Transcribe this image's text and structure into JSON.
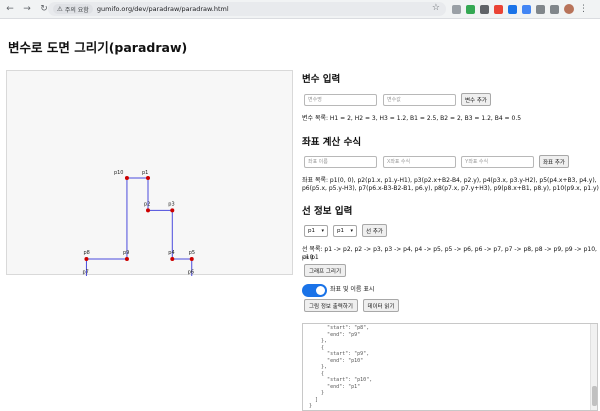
{
  "browser": {
    "security_label": "주의 요함",
    "url": "gumifo.org/dev/paradraw/paradraw.html"
  },
  "page": {
    "title": "변수로 도면 그리기(paradraw)"
  },
  "variables": {
    "heading": "변수 입력",
    "name_placeholder": "변수명",
    "value_placeholder": "변수값",
    "add_label": "변수 추가",
    "list_text": "변수 목록: H1 = 2, H2 = 3, H3 = 1.2, B1 = 2.5, B2 = 2, B3 = 1.2, B4 = 0.5"
  },
  "coords": {
    "heading": "좌표 계산 수식",
    "name_placeholder": "좌표 이름",
    "x_placeholder": "X좌표 수식",
    "y_placeholder": "Y좌표 수식",
    "add_label": "좌표 추가",
    "list_line1": "좌표 목록: p1(0, 0), p2(p1.x, p1.y-H1), p3(p2.x+B2-B4, p2.y), p4(p3.x, p3.y-H2), p5(p4.x+B3, p4.y),",
    "list_line2": "p6(p5.x, p5.y-H3), p7(p6.x-B3-B2-B1, p6.y), p8(p7.x, p7.y+H3), p9(p8.x+B1, p8.y), p10(p9.x, p1.y)"
  },
  "lines": {
    "heading": "선 정보 입력",
    "start_value": "p1",
    "end_value": "p1",
    "add_label": "선 추가",
    "list_line1": "선 목록: p1 -> p2, p2 -> p3, p3 -> p4, p4 -> p5, p5 -> p6, p6 -> p7, p7 -> p8, p8 -> p9, p9 -> p10, p10",
    "list_line2": "-> p1",
    "draw_label": "그래프 그리기",
    "toggle_label": "좌표 및 이름 표시",
    "toggle_on": true,
    "export_label": "그림 정보 출력하기",
    "load_label": "데이터 읽기"
  },
  "json_output": "      \"start\": \"p8\",\n      \"end\": \"p9\"\n    },\n    {\n      \"start\": \"p9\",\n      \"end\": \"p10\"\n    },\n    {\n      \"start\": \"p10\",\n      \"end\": \"p1\"\n    }\n  ]\n}",
  "drawing": {
    "line_color": "#4b4bdc",
    "point_color": "#cc0000",
    "points": [
      {
        "name": "p1",
        "x": 0,
        "y": 0
      },
      {
        "name": "p2",
        "x": 0,
        "y": -2
      },
      {
        "name": "p3",
        "x": 1.5,
        "y": -2
      },
      {
        "name": "p4",
        "x": 1.5,
        "y": -5
      },
      {
        "name": "p5",
        "x": 2.7,
        "y": -5
      },
      {
        "name": "p6",
        "x": 2.7,
        "y": -6.2
      },
      {
        "name": "p7",
        "x": -3.8,
        "y": -6.2
      },
      {
        "name": "p8",
        "x": -3.8,
        "y": -5
      },
      {
        "name": "p9",
        "x": -1.3,
        "y": -5
      },
      {
        "name": "p10",
        "x": -1.3,
        "y": 0
      }
    ],
    "segments": [
      [
        "p1",
        "p2"
      ],
      [
        "p2",
        "p3"
      ],
      [
        "p3",
        "p4"
      ],
      [
        "p4",
        "p5"
      ],
      [
        "p5",
        "p6"
      ],
      [
        "p6",
        "p7"
      ],
      [
        "p7",
        "p8"
      ],
      [
        "p8",
        "p9"
      ],
      [
        "p9",
        "p10"
      ],
      [
        "p10",
        "p1"
      ]
    ]
  }
}
